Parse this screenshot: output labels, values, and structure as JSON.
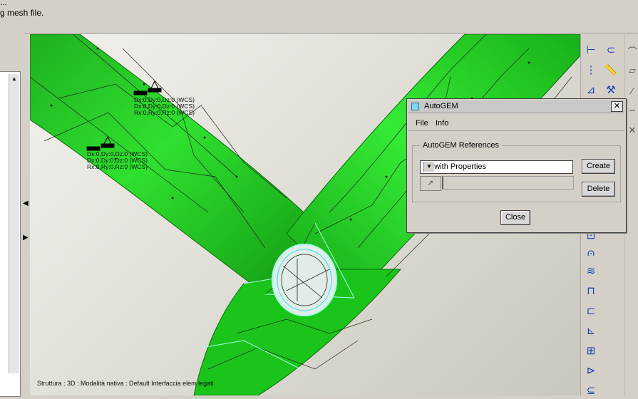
{
  "message_area": {
    "line1": "...",
    "line2": "g mesh file."
  },
  "viewport": {
    "status_text": "Struttura : 3D : Modalità nativa : Default Interfaccia elem legati",
    "constraint_1": {
      "line1": "Dx:0,Dy:0,Dz:0 (WCS)",
      "line2": "Dx:0,Dy:0,Dz:0 (WCS)",
      "line3": "Rx:0,Ry:0,Rz:0 (WCS)"
    },
    "constraint_2": {
      "line1": "Dx:0,Dy:0,Dz:0 (WCS)",
      "line2": "Dx:0,Dy:0,Dz:0 (WCS)",
      "line3": "Rx:0,Ry:0,Rz:0 (WCS)"
    },
    "model_color": "#22cc22",
    "mesh_color": "#1b2a1b",
    "edge_color": "#a8ffe8"
  },
  "toolbar_icons": [
    "datum-plane-icon",
    "datum-axis-icon",
    "datum-csys-icon",
    "measure-icon",
    "coordinate-system-icon",
    "hammer-icon",
    "load-icon",
    "force-icon",
    "constraint-icon",
    "spring-icon",
    "mass-icon",
    "beam-icon",
    "shell-icon",
    "weld-icon",
    "rigid-link-icon",
    "simulation-icon"
  ],
  "dialog": {
    "title": "AutoGEM",
    "menu": [
      "File",
      "Info"
    ],
    "references_label": "AutoGEM References",
    "references_value": "All with Properties",
    "create_label": "Create",
    "delete_label": "Delete",
    "close_label": "Close"
  }
}
